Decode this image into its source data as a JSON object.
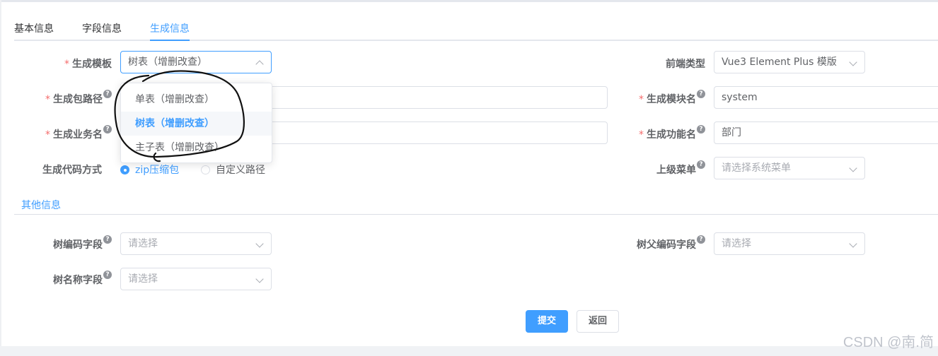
{
  "tabs": [
    {
      "label": "基本信息",
      "active": false
    },
    {
      "label": "字段信息",
      "active": false
    },
    {
      "label": "生成信息",
      "active": true
    }
  ],
  "form": {
    "template": {
      "label": "生成模板",
      "required": true,
      "value": "树表（增删改查）"
    },
    "frontend_type": {
      "label": "前端类型",
      "value": "Vue3 Element Plus 模版"
    },
    "package_path": {
      "label": "生成包路径",
      "required": true,
      "value": ""
    },
    "module_name": {
      "label": "生成模块名",
      "required": true,
      "value": "system"
    },
    "business_name": {
      "label": "生成业务名",
      "required": true,
      "value": ""
    },
    "function_name": {
      "label": "生成功能名",
      "required": true,
      "value": "部门"
    },
    "gen_type": {
      "label": "生成代码方式",
      "options": [
        {
          "label": "zip压缩包",
          "checked": true
        },
        {
          "label": "自定义路径",
          "checked": false
        }
      ]
    },
    "parent_menu": {
      "label": "上级菜单",
      "placeholder": "请选择系统菜单"
    }
  },
  "other_section": {
    "title": "其他信息",
    "tree_code": {
      "label": "树编码字段",
      "placeholder": "请选择"
    },
    "tree_parent_code": {
      "label": "树父编码字段",
      "placeholder": "请选择"
    },
    "tree_name": {
      "label": "树名称字段",
      "placeholder": "请选择"
    }
  },
  "template_dropdown": {
    "options": [
      {
        "label": "单表（增删改查）",
        "selected": false
      },
      {
        "label": "树表（增删改查）",
        "selected": true
      },
      {
        "label": "主子表（增删改查）",
        "selected": false
      }
    ]
  },
  "buttons": {
    "submit": "提交",
    "back": "返回"
  },
  "help_icon": "?",
  "watermark": "CSDN @南.简",
  "colors": {
    "accent": "#409eff",
    "required": "#f56c6c"
  }
}
